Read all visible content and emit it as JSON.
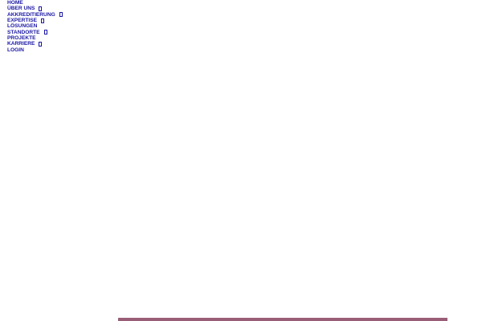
{
  "nav": {
    "items": [
      {
        "label": "HOME",
        "has_submenu": false
      },
      {
        "label": "ÜBER UNS",
        "has_submenu": true
      },
      {
        "label": "AKKREDITIERUNG",
        "has_submenu": true
      },
      {
        "label": "EXPERTISE",
        "has_submenu": true
      },
      {
        "label": "LÖSUNGEN",
        "has_submenu": false
      },
      {
        "label": "STANDORTE",
        "has_submenu": true
      },
      {
        "label": "PROJEKTE",
        "has_submenu": false
      },
      {
        "label": "KARRIERE",
        "has_submenu": true
      },
      {
        "label": "LOGIN",
        "has_submenu": false
      }
    ],
    "link_color": "#1a16a3"
  },
  "banner": {
    "color": "#9a5d78"
  }
}
